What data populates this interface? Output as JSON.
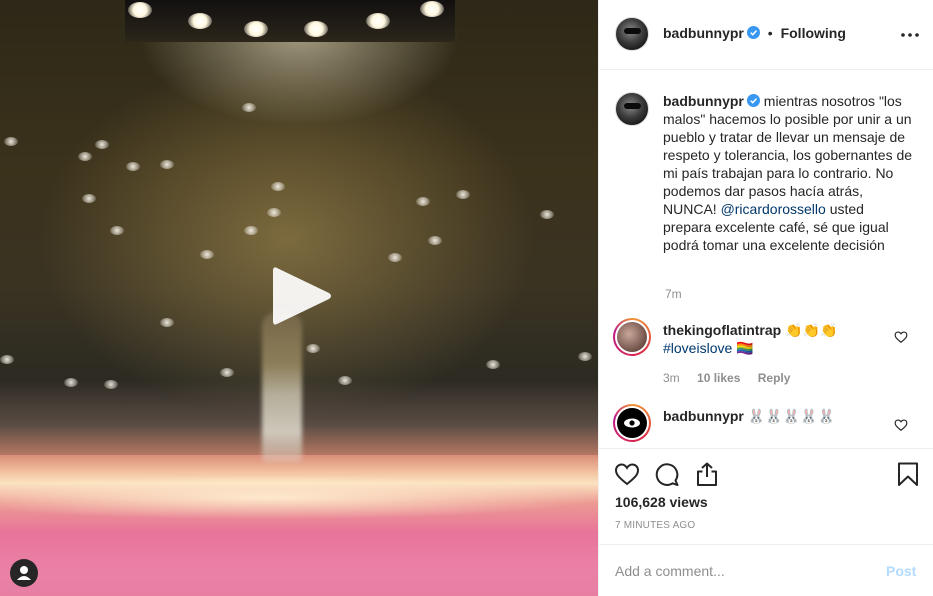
{
  "post": {
    "username": "badbunnypr",
    "verified": true,
    "follow_status": "Following",
    "more_icon": "more-horizontal-icon"
  },
  "caption": {
    "username": "badbunnypr",
    "text_before_mention": "mientras nosotros \"los malos\" hacemos lo posible por unir a un pueblo y tratar de llevar un mensaje de respeto y tolerancia, los gobernantes de mi país trabajan para lo contrario. No podemos dar pasos hacía atrás, NUNCA!",
    "mention": "@ricardorossello",
    "text_after_mention": "usted prepara excelente café, sé que igual podrá tomar una excelente decisión",
    "time": "7m"
  },
  "comments": [
    {
      "username": "thekingoflatintrap",
      "text": "👏👏👏",
      "hashtag": "#loveislove",
      "emoji_after": "🏳️‍🌈",
      "time": "3m",
      "likes": "10 likes",
      "reply": "Reply"
    },
    {
      "username": "badbunnypr",
      "text": "🐰🐰🐰🐰🐰"
    }
  ],
  "stats": {
    "views": "106,628 views",
    "posted": "7 MINUTES AGO"
  },
  "add_comment": {
    "placeholder": "Add a comment...",
    "post_label": "Post"
  },
  "icons": {
    "play": "play-icon",
    "user_tag": "user-tag-icon",
    "like": "heart-icon",
    "comment": "comment-icon",
    "share": "share-icon",
    "save": "bookmark-icon"
  },
  "colors": {
    "text": "#262626",
    "muted": "#8e8e8e",
    "link": "#00376b",
    "verified": "#3897f0",
    "post_disabled": "#b3dbff"
  }
}
